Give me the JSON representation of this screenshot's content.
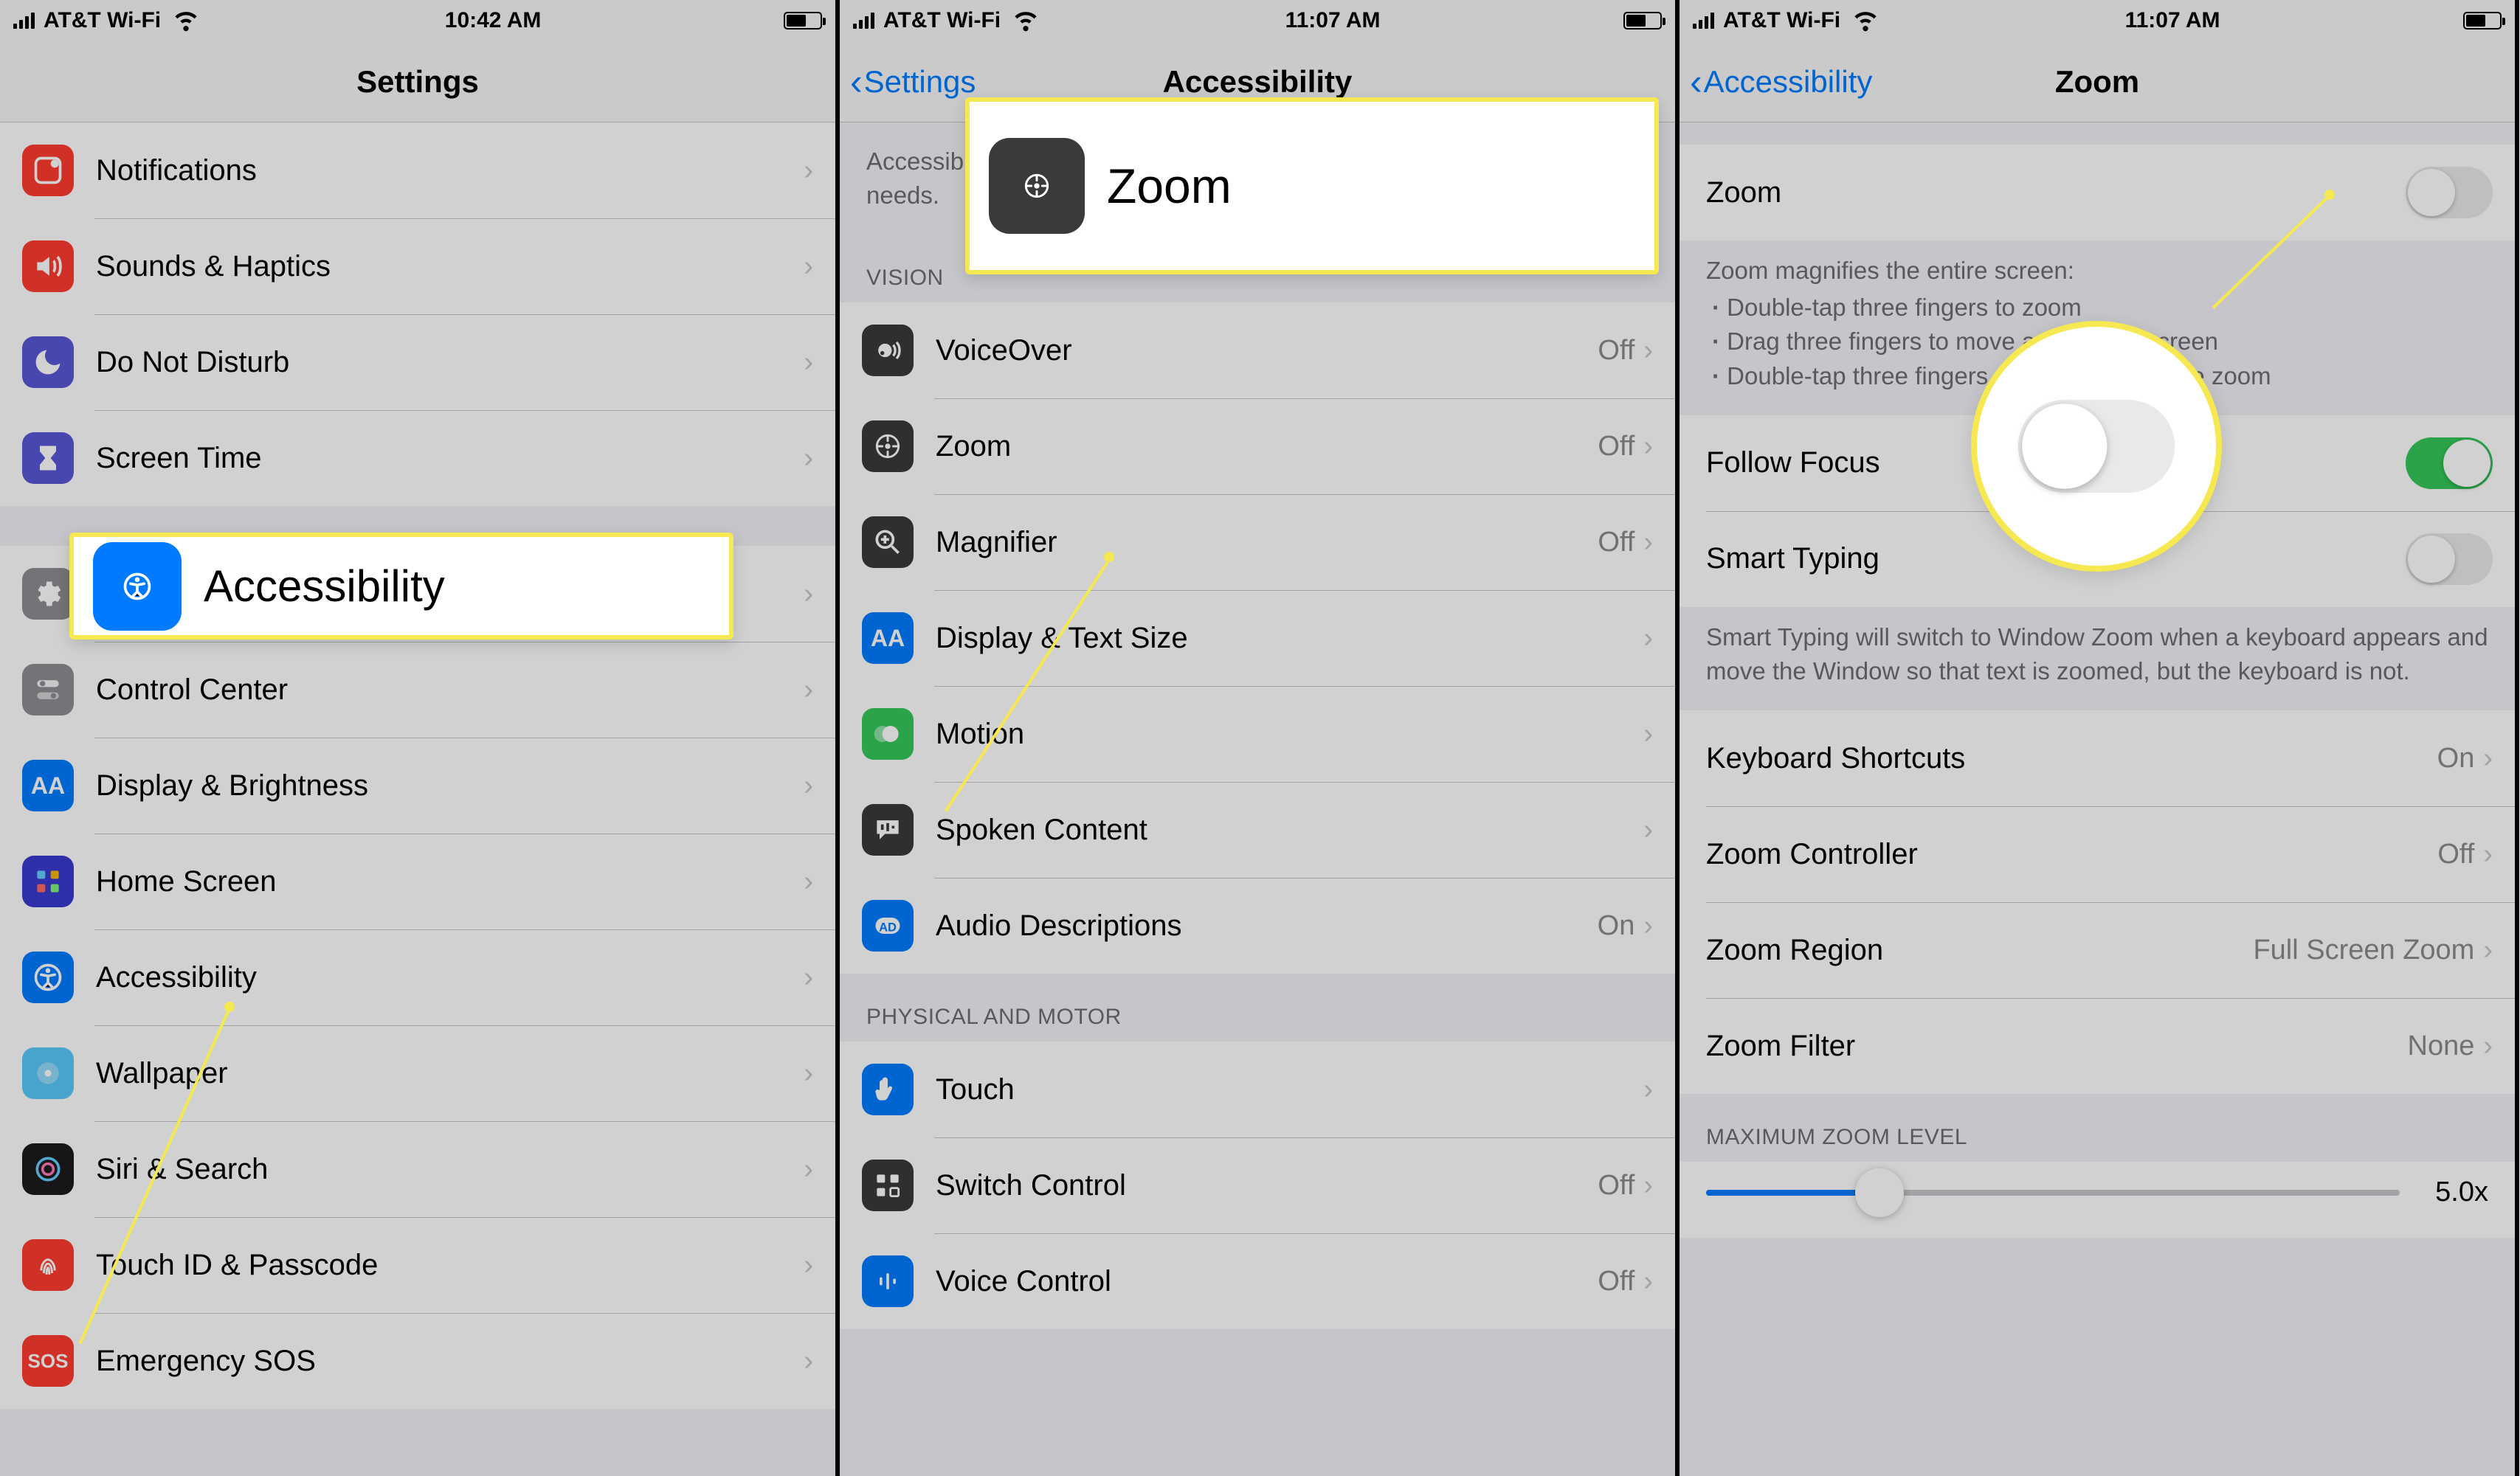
{
  "status": {
    "carrier": "AT&T Wi-Fi"
  },
  "panel1": {
    "time": "10:42 AM",
    "title": "Settings",
    "rows_a": [
      {
        "label": "Notifications"
      },
      {
        "label": "Sounds & Haptics"
      },
      {
        "label": "Do Not Disturb"
      },
      {
        "label": "Screen Time"
      }
    ],
    "rows_b": [
      {
        "label": "General"
      },
      {
        "label": "Control Center"
      },
      {
        "label": "Display & Brightness"
      },
      {
        "label": "Home Screen"
      },
      {
        "label": "Accessibility"
      },
      {
        "label": "Wallpaper"
      },
      {
        "label": "Siri & Search"
      },
      {
        "label": "Touch ID & Passcode"
      },
      {
        "label": "Emergency SOS"
      }
    ],
    "callout_label": "Accessibility"
  },
  "panel2": {
    "time": "11:07 AM",
    "back": "Settings",
    "title": "Accessibility",
    "intro_partial": "Accessibility features help you customize your iPhone for your individual needs.",
    "section_vision": "VISION",
    "vision_rows": [
      {
        "label": "VoiceOver",
        "value": "Off"
      },
      {
        "label": "Zoom",
        "value": "Off"
      },
      {
        "label": "Magnifier",
        "value": "Off"
      },
      {
        "label": "Display & Text Size",
        "value": ""
      },
      {
        "label": "Motion",
        "value": ""
      },
      {
        "label": "Spoken Content",
        "value": ""
      },
      {
        "label": "Audio Descriptions",
        "value": "On"
      }
    ],
    "section_physical": "PHYSICAL AND MOTOR",
    "physical_rows": [
      {
        "label": "Touch",
        "value": ""
      },
      {
        "label": "Switch Control",
        "value": "Off"
      },
      {
        "label": "Voice Control",
        "value": "Off"
      }
    ],
    "callout_label": "Zoom"
  },
  "panel3": {
    "time": "11:07 AM",
    "back": "Accessibility",
    "title": "Zoom",
    "zoom_row_label": "Zoom",
    "zoom_help_title": "Zoom magnifies the entire screen:",
    "zoom_help_lines": [
      "Double-tap three fingers to zoom",
      "Drag three fingers to move around the screen",
      "Double-tap three fingers and drag to change zoom"
    ],
    "follow_focus_label": "Follow Focus",
    "smart_typing_label": "Smart Typing",
    "smart_typing_help": "Smart Typing will switch to Window Zoom when a keyboard appears and move the Window so that text is zoomed, but the keyboard is not.",
    "rows": [
      {
        "label": "Keyboard Shortcuts",
        "value": "On"
      },
      {
        "label": "Zoom Controller",
        "value": "Off"
      },
      {
        "label": "Zoom Region",
        "value": "Full Screen Zoom"
      },
      {
        "label": "Zoom Filter",
        "value": "None"
      }
    ],
    "max_zoom_header": "MAXIMUM ZOOM LEVEL",
    "max_zoom_value": "5.0x"
  }
}
